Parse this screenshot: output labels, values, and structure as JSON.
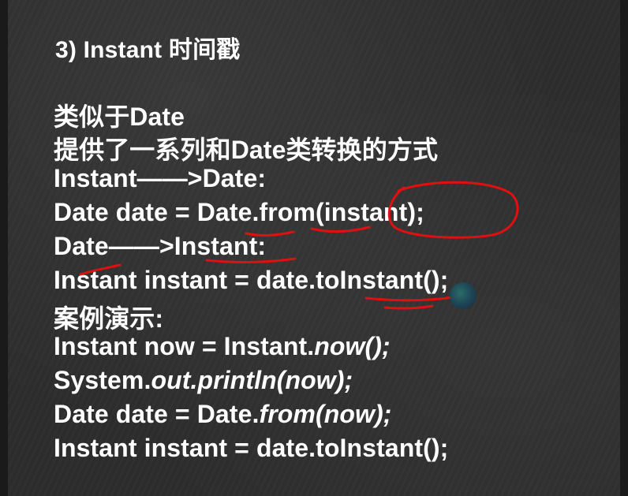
{
  "title": "3) Instant 时间戳",
  "lines": [
    "类似于Date",
    "提供了一系列和Date类转换的方式",
    "Instant——>Date:",
    "Date  date = Date.from(instant);",
    "Date——>Instant:",
    "Instant instant = date.toInstant();",
    "案例演示:"
  ],
  "example": {
    "line1_prefix": "Instant now = Instant.",
    "line1_italic": "now();",
    "line2_prefix": "System.",
    "line2_italic": "out.println(now);",
    "line3_prefix": "Date date = Date.",
    "line3_italic": "from(now);",
    "line4": "Instant instant = date.toInstant();"
  },
  "colors": {
    "background": "#2d2d2d",
    "text": "#ffffff",
    "annotation": "#e01010"
  }
}
